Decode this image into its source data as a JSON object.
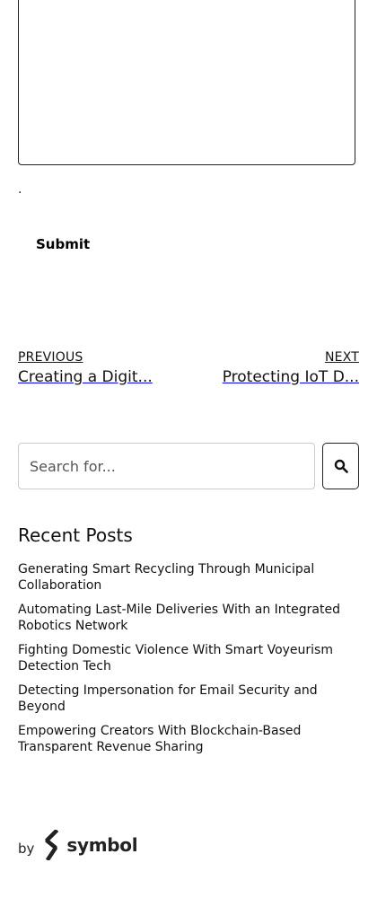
{
  "comment": {
    "value": "",
    "trailing_dot": "."
  },
  "form": {
    "submit_label": "Submit"
  },
  "post_nav": {
    "previous": {
      "kicker": "PREVIOUS",
      "title": "Creating a Digit..."
    },
    "next": {
      "kicker": "NEXT",
      "title": "Protecting IoT D..."
    }
  },
  "search": {
    "placeholder": "Search for...",
    "button_icon": "search-icon"
  },
  "recent_posts": {
    "heading": "Recent Posts",
    "items": [
      {
        "title": "Generating Smart Recycling Through Municipal Collaboration"
      },
      {
        "title": "Automating Last-Mile Deliveries With an Integrated Robotics Network"
      },
      {
        "title": "Fighting Domestic Violence With Smart Voyeurism Detection Tech"
      },
      {
        "title": "Detecting Impersonation for Email Security and Beyond"
      },
      {
        "title": "Empowering Creators With Blockchain-Based Transparent Revenue Sharing"
      }
    ]
  },
  "footer": {
    "by": "by",
    "brand_name": "symbol",
    "brand_icon": "symbol-logo-icon"
  },
  "colors": {
    "text": "#111111",
    "border": "#222222",
    "input_border": "#cccccc"
  }
}
